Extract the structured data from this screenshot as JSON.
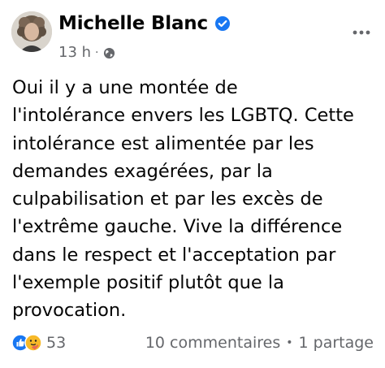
{
  "post": {
    "author": "Michelle Blanc",
    "time": "13 h",
    "meta_separator": "·",
    "body": "Oui il y a une montée de\nl'intolérance envers les LGBTQ. Cette\nintolérance est alimentée par les\ndemandes exagérées, par la\nculpabilisation et par les excès de\nl'extrême gauche.  Vive la différence\ndans le respect et l'acceptation par\nl'exemple positif plutôt que la\nprovocation.",
    "reactions": {
      "count": "53",
      "icons": [
        "like-icon",
        "care-icon"
      ]
    },
    "comments": "10 commentaires",
    "stats_separator": "•",
    "shares": "1 partage"
  },
  "colors": {
    "primary_text": "#050505",
    "secondary_text": "#65676b",
    "verified_blue": "#1877f2",
    "like_blue": "#1877f2",
    "care_yellow": "#f7b928"
  },
  "icons": {
    "verified": "verified-badge-icon",
    "audience": "globe-icon",
    "menu": "more-options-icon"
  }
}
